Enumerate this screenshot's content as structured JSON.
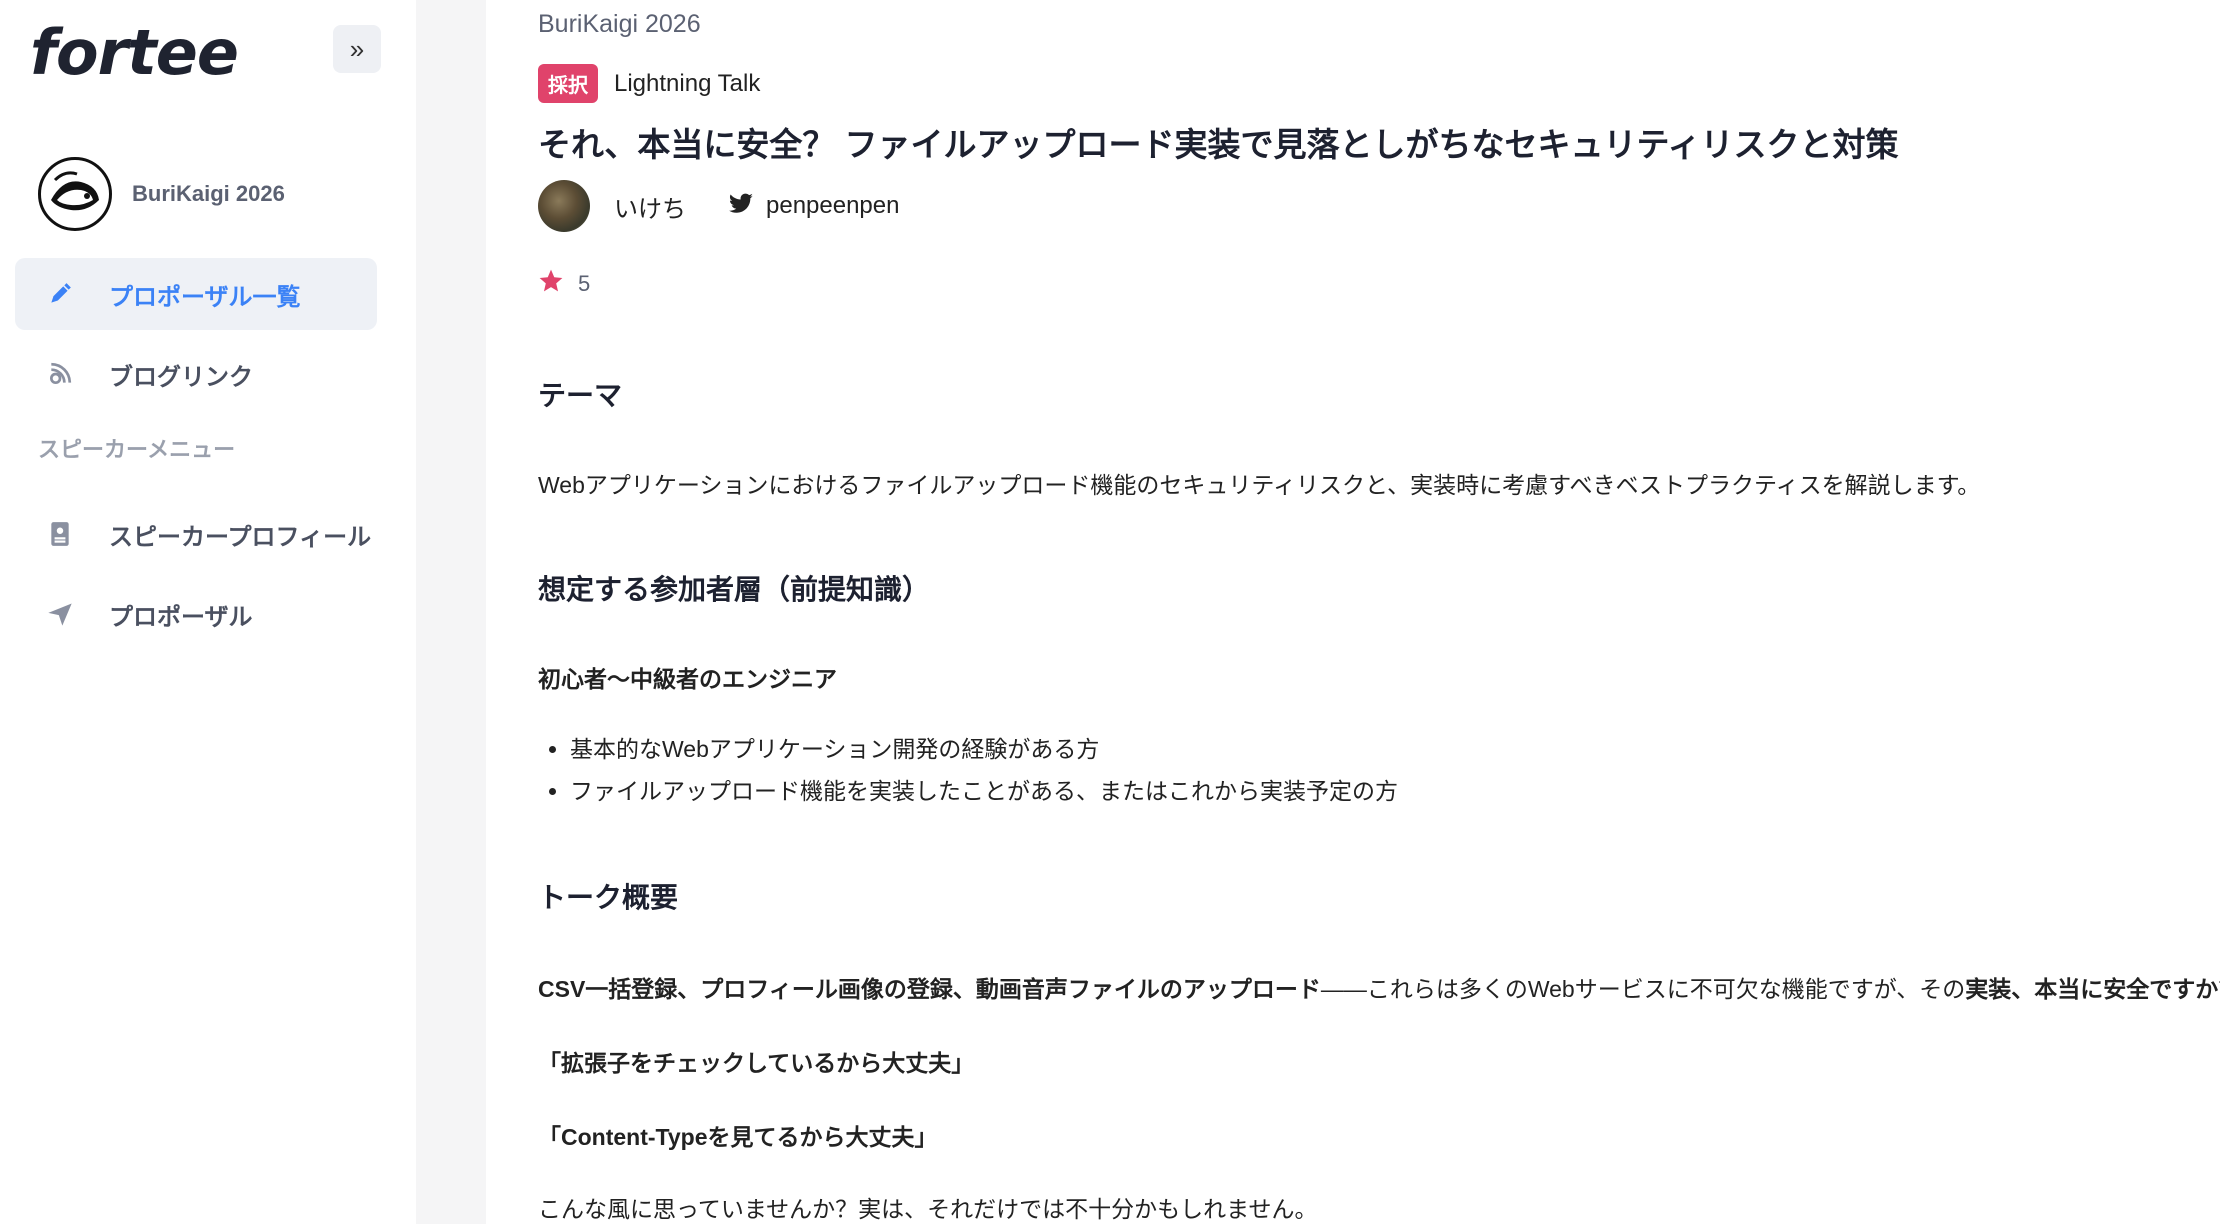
{
  "sidebar": {
    "logo": "fortee",
    "collapse_icon": "»",
    "event_name": "BuriKaigi 2026",
    "nav_items": [
      {
        "label": "プロポーザル一覧",
        "icon": "pencil-icon",
        "active": true
      },
      {
        "label": "ブログリンク",
        "icon": "link-icon",
        "active": false
      }
    ],
    "speaker_menu_label": "スピーカーメニュー",
    "speaker_items": [
      {
        "label": "スピーカープロフィール",
        "icon": "id-card-icon"
      },
      {
        "label": "プロポーザル",
        "icon": "paper-plane-icon"
      }
    ]
  },
  "proposal": {
    "event": "BuriKaigi 2026",
    "badge": "採択",
    "talk_type": "Lightning Talk",
    "title": "それ、本当に安全？ ファイルアップロード実装で見落としがちなセキュリティリスクと対策",
    "speaker_name": "いけち",
    "twitter_handle": "penpeenpen",
    "star_count": "5"
  },
  "sections": {
    "theme_heading": "テーマ",
    "theme_text": "Webアプリケーションにおけるファイルアップロード機能のセキュリティリスクと、実装時に考慮すべきベストプラクティスを解説します。",
    "audience_heading": "想定する参加者層（前提知識）",
    "audience_sub": "初心者〜中級者のエンジニア",
    "audience_bullets": [
      "基本的なWebアプリケーション開発の経験がある方",
      "ファイルアップロード機能を実装したことがある、またはこれから実装予定の方"
    ],
    "overview_heading": "トーク概要",
    "overview_p1_bold": "CSV一括登録、プロフィール画像の登録、動画音声ファイルのアップロード",
    "overview_p1_mid": "——これらは多くのWebサービスに不可欠な機能ですが、その",
    "overview_p1_bold2": "実装、本当に安全ですか",
    "overview_p1_end": "？",
    "quote1": "「拡張子をチェックしているから大丈夫」",
    "quote2": "「Content-Typeを見てるから大丈夫」",
    "closing": "こんな風に思っていませんか？実は、それだけでは不十分かもしれません。"
  },
  "colors": {
    "accent": "#3b82f6",
    "badge": "#e0436b",
    "star": "#e0436b"
  }
}
